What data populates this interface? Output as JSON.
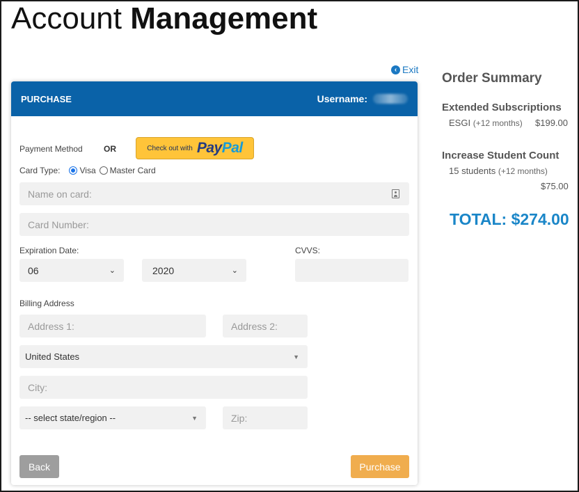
{
  "page": {
    "title_light": "Account",
    "title_bold": "Management",
    "exit_label": "Exit"
  },
  "purchase": {
    "header_title": "PURCHASE",
    "username_label": "Username:",
    "payment_method_label": "Payment Method",
    "or_label": "OR",
    "paypal": {
      "prefix": "Check out with",
      "logo_part1": "Pay",
      "logo_part2": "Pal"
    },
    "card_type_label": "Card Type:",
    "card_types": [
      {
        "label": "Visa",
        "checked": true
      },
      {
        "label": "Master Card",
        "checked": false
      }
    ],
    "name_on_card_placeholder": "Name on card:",
    "card_number_placeholder": "Card Number:",
    "expiration_label": "Expiration Date:",
    "exp_month": "06",
    "exp_year": "2020",
    "cvvs_label": "CVVS:",
    "billing_address_label": "Billing Address",
    "address1_placeholder": "Address 1:",
    "address2_placeholder": "Address 2:",
    "country": "United States",
    "city_placeholder": "City:",
    "state_placeholder": "-- select state/region --",
    "zip_placeholder": "Zip:",
    "back_label": "Back",
    "purchase_label": "Purchase"
  },
  "summary": {
    "title": "Order Summary",
    "sections": [
      {
        "heading": "Extended Subscriptions",
        "item": "ESGI",
        "item_note": "(+12 months)",
        "price": "$199.00"
      },
      {
        "heading": "Increase Student Count",
        "item": "15 students",
        "item_note": "(+12 months)",
        "price": "$75.00"
      }
    ],
    "total": "TOTAL: $274.00"
  },
  "colors": {
    "header_blue": "#0a62a8",
    "total_blue": "#1a86c8",
    "paypal_yellow": "#ffc439",
    "purchase_orange": "#f0ad4e",
    "back_gray": "#9e9e9e"
  }
}
